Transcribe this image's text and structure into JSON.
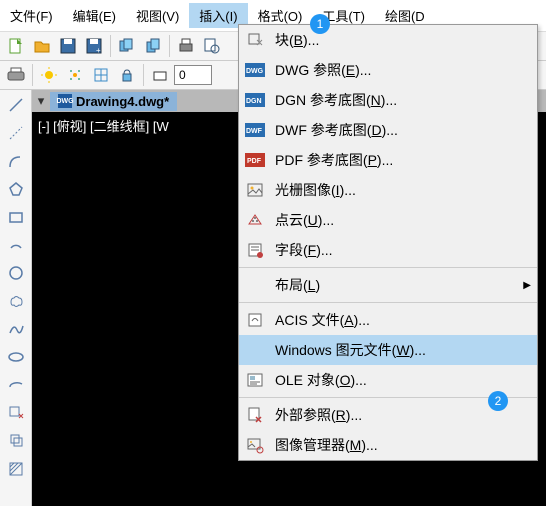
{
  "menubar": {
    "file": "文件(F)",
    "edit": "编辑(E)",
    "view": "视图(V)",
    "insert": "插入(I)",
    "format": "格式(O)",
    "tools": "工具(T)",
    "draw": "绘图(D"
  },
  "toolbar2": {
    "line_weight_value": "0"
  },
  "tab": {
    "filename": "Drawing4.dwg*"
  },
  "viewport": {
    "label": "[-] [俯视] [二维线框] [W"
  },
  "dropdown": {
    "block": "块(B)...",
    "dwg_ref": "DWG 参照(E)...",
    "dgn_ref": "DGN 参考底图(N)...",
    "dwf_ref": "DWF 参考底图(D)...",
    "pdf_ref": "PDF 参考底图(P)...",
    "raster": "光栅图像(I)...",
    "point_cloud": "点云(U)...",
    "field": "字段(F)...",
    "layout": "布局(L)",
    "acis": "ACIS 文件(A)...",
    "wmf": "Windows 图元文件(W)...",
    "ole": "OLE 对象(O)...",
    "xref": "外部参照(R)...",
    "imgmgr": "图像管理器(M)..."
  },
  "badges": {
    "one": "1",
    "two": "2"
  }
}
